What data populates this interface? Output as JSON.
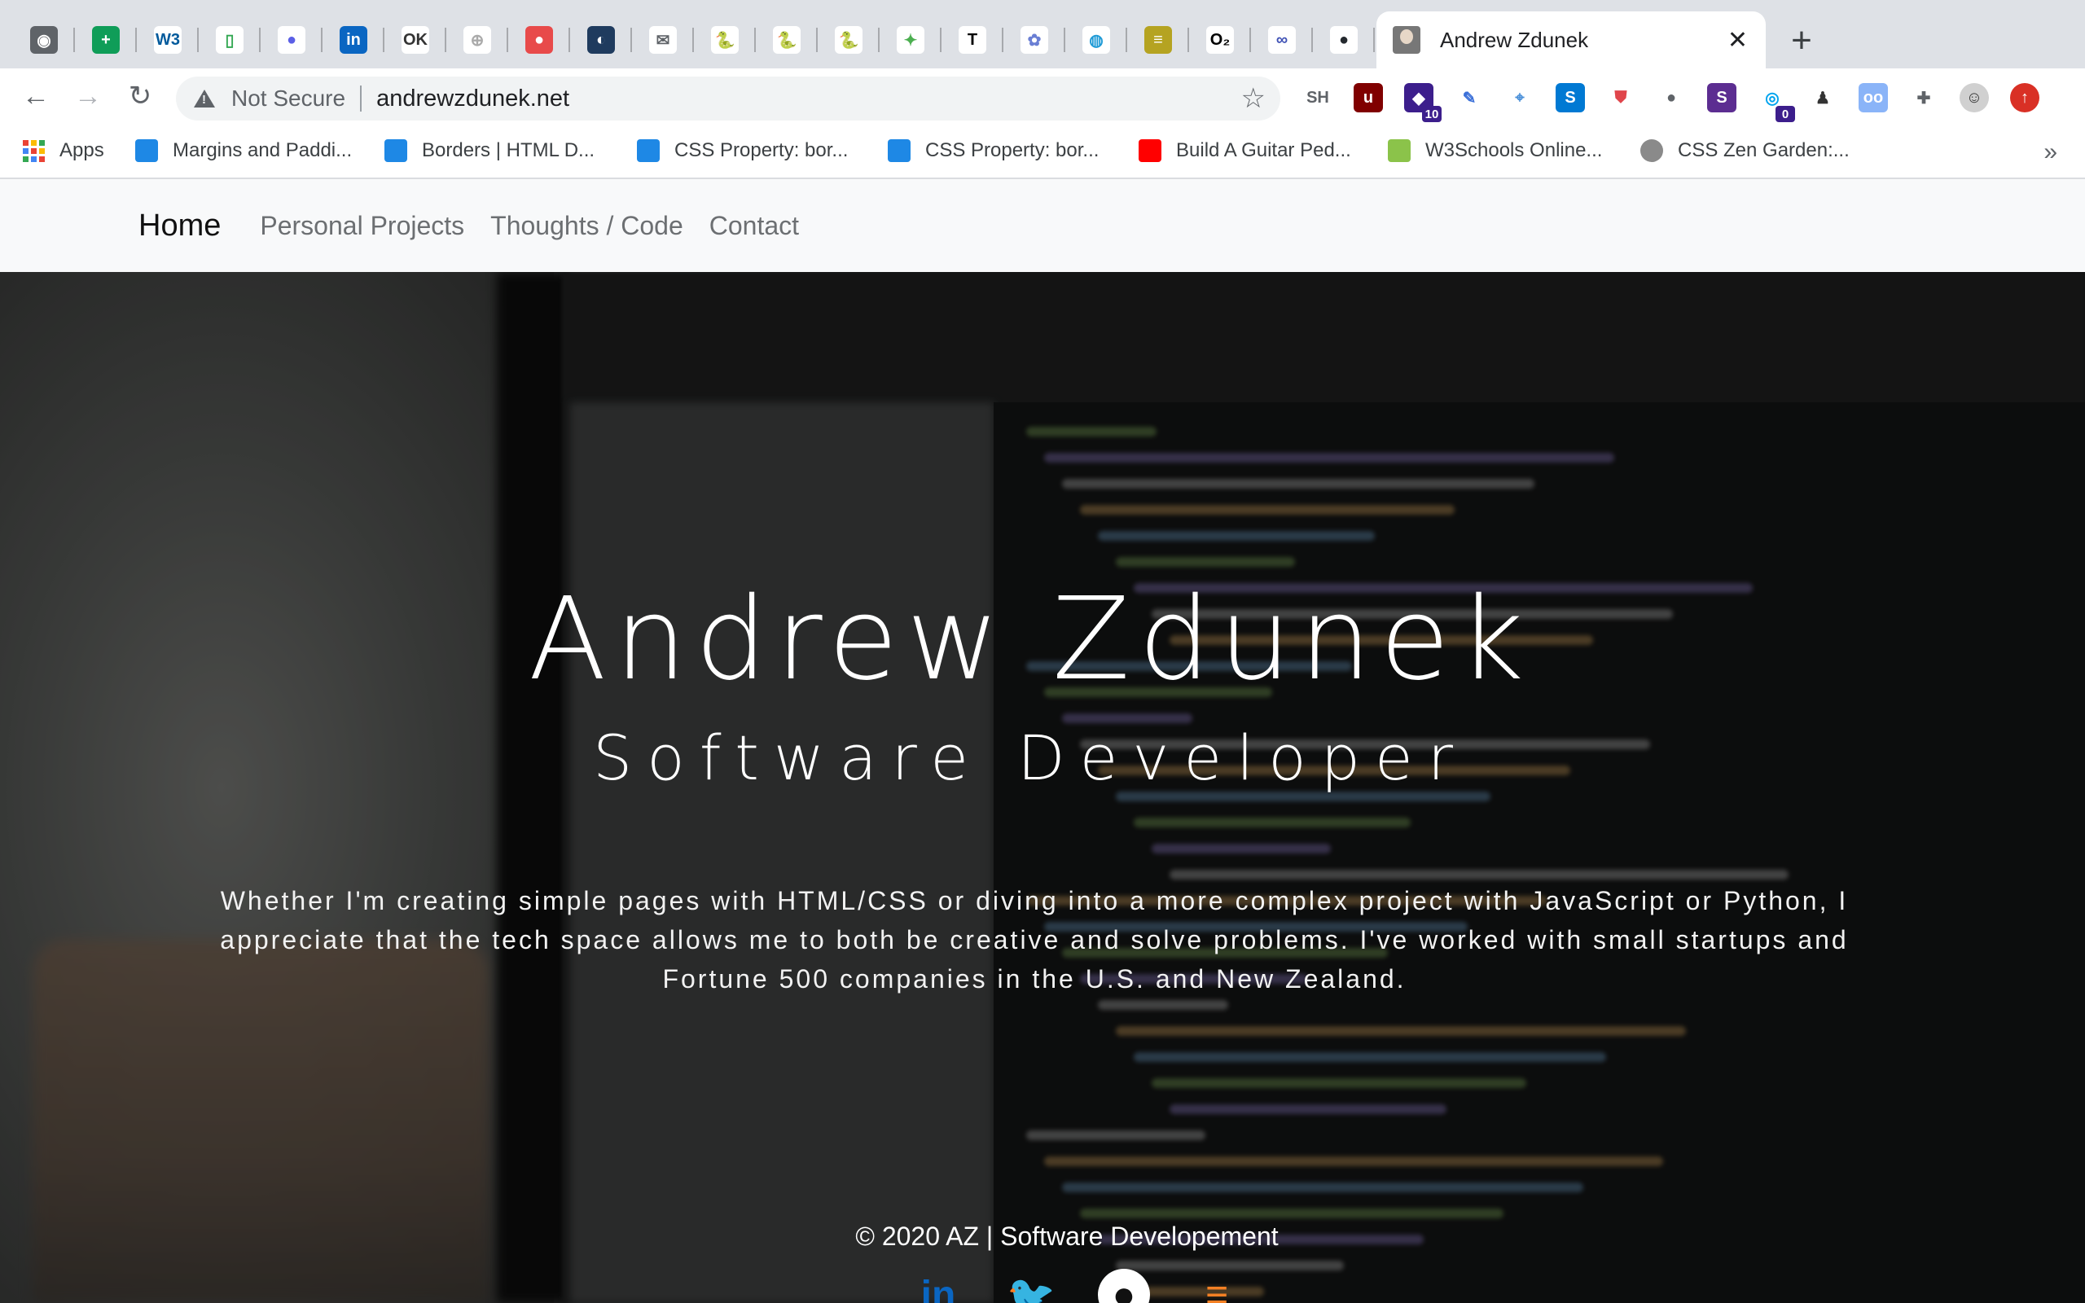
{
  "browser": {
    "pinned_tabs": [
      {
        "icon": "globe-icon",
        "glyph": "◉",
        "bg": "#5f6368"
      },
      {
        "icon": "google-sheets-icon",
        "glyph": "+",
        "bg": "#0f9d58"
      },
      {
        "icon": "w3c-icon",
        "glyph": "W3",
        "bg": "#ffffff",
        "fg": "#005a9c"
      },
      {
        "icon": "phone-outline-icon",
        "glyph": "▯",
        "bg": "#ffffff",
        "fg": "#34a853"
      },
      {
        "icon": "purple-circle-icon",
        "glyph": "●",
        "bg": "#ffffff",
        "fg": "#5b5fe6"
      },
      {
        "icon": "linkedin-icon",
        "glyph": "in",
        "bg": "#0a66c2"
      },
      {
        "icon": "ok-icon",
        "glyph": "OK",
        "bg": "#ffffff",
        "fg": "#333333"
      },
      {
        "icon": "crosshair-icon",
        "glyph": "⊕",
        "bg": "#ffffff",
        "fg": "#aaaaaa"
      },
      {
        "icon": "red-pin-icon",
        "glyph": "●",
        "bg": "#e84a4a"
      },
      {
        "icon": "blue-wave-icon",
        "glyph": "◐",
        "bg": "#1f3b5e"
      },
      {
        "icon": "mail-icon",
        "glyph": "✉",
        "bg": "#ffffff",
        "fg": "#5f6368"
      },
      {
        "icon": "python-icon",
        "glyph": "🐍",
        "bg": "#ffffff",
        "fg": "#3776ab"
      },
      {
        "icon": "python-icon",
        "glyph": "🐍",
        "bg": "#ffffff",
        "fg": "#3776ab"
      },
      {
        "icon": "python-icon",
        "glyph": "🐍",
        "bg": "#ffffff",
        "fg": "#3776ab"
      },
      {
        "icon": "plant-icon",
        "glyph": "✦",
        "bg": "#ffffff",
        "fg": "#4caf50"
      },
      {
        "icon": "text-t-icon",
        "glyph": "T",
        "bg": "#ffffff",
        "fg": "#000000"
      },
      {
        "icon": "flower-icon",
        "glyph": "✿",
        "bg": "#ffffff",
        "fg": "#6a7fd4"
      },
      {
        "icon": "globe-blue-icon",
        "glyph": "◍",
        "bg": "#ffffff",
        "fg": "#1e9ad6"
      },
      {
        "icon": "stack-icon",
        "glyph": "≡",
        "bg": "#b5a321"
      },
      {
        "icon": "o2-icon",
        "glyph": "O₂",
        "bg": "#ffffff",
        "fg": "#000000"
      },
      {
        "icon": "infinity-icon",
        "glyph": "∞",
        "bg": "#ffffff",
        "fg": "#3f51b5"
      },
      {
        "icon": "github-icon",
        "glyph": "●",
        "bg": "#ffffff",
        "fg": "#24292e"
      }
    ],
    "active_tab": {
      "title": "Andrew Zdunek",
      "close": "✕"
    },
    "new_tab": "+",
    "address": {
      "security": "Not Secure",
      "url": "andrewzdunek.net"
    },
    "extensions": [
      {
        "icon": "sh-text-icon",
        "glyph": "SH",
        "bg": "#ffffff",
        "fg": "#5f6368"
      },
      {
        "icon": "ublock-icon",
        "glyph": "u",
        "bg": "#800000"
      },
      {
        "icon": "graduation-cap-icon",
        "glyph": "◆",
        "bg": "#3c1e8c",
        "badge": "10"
      },
      {
        "icon": "feather-icon",
        "glyph": "✎",
        "bg": "#ffffff",
        "fg": "#3a6fd8"
      },
      {
        "icon": "map-icon",
        "glyph": "⌖",
        "bg": "#ffffff",
        "fg": "#4a90d9"
      },
      {
        "icon": "s-box-icon",
        "glyph": "S",
        "bg": "#0079d3"
      },
      {
        "icon": "shield-red-icon",
        "glyph": "⛊",
        "bg": "#ffffff",
        "fg": "#e0454b"
      },
      {
        "icon": "chat-bubble-icon",
        "glyph": "●",
        "bg": "#ffffff",
        "fg": "#5f6368"
      },
      {
        "icon": "s-purple-icon",
        "glyph": "S",
        "bg": "#5c2d91"
      },
      {
        "icon": "ghost-icon",
        "glyph": "◎",
        "bg": "#ffffff",
        "fg": "#00a4ef",
        "badge": "0"
      },
      {
        "icon": "person-icon",
        "glyph": "♟",
        "bg": "#ffffff",
        "fg": "#333333"
      },
      {
        "icon": "glasses-icon",
        "glyph": "oo",
        "bg": "#8ab4f8"
      },
      {
        "icon": "puzzle-icon",
        "glyph": "✚",
        "bg": "#ffffff",
        "fg": "#5f6368"
      },
      {
        "icon": "avatar-icon",
        "glyph": "☺",
        "bg": "#d0d0d0",
        "fg": "#333333"
      },
      {
        "icon": "update-icon",
        "glyph": "↑",
        "bg": "#d93025"
      }
    ],
    "bookmarks": [
      {
        "label": "Apps",
        "icon": "apps-grid-icon"
      },
      {
        "label": "Margins and Paddi...",
        "icon": "w3-feather-icon"
      },
      {
        "label": "Borders | HTML D...",
        "icon": "w3-feather-icon"
      },
      {
        "label": "CSS Property: bor...",
        "icon": "w3-feather-icon"
      },
      {
        "label": "CSS Property: bor...",
        "icon": "w3-feather-icon"
      },
      {
        "label": "Build A Guitar Ped...",
        "icon": "youtube-icon"
      },
      {
        "label": "W3Schools Online...",
        "icon": "w3schools-icon"
      },
      {
        "label": "CSS Zen Garden:...",
        "icon": "zen-garden-icon"
      }
    ],
    "bookmarks_overflow": "»"
  },
  "site": {
    "nav": {
      "brand": "Home",
      "links": [
        "Personal Projects",
        "Thoughts / Code",
        "Contact"
      ]
    },
    "hero": {
      "name": "Andrew Zdunek",
      "role": "Software Developer",
      "bio": "Whether I'm creating simple pages with HTML/CSS or diving into a more complex project with JavaScript or Python, I appreciate that the tech space allows me to both be creative and solve problems. I've worked with small startups and Fortune 500 companies in the U.S. and New Zealand."
    },
    "footer": "© 2020 AZ | Software Developement",
    "socials": [
      {
        "icon": "linkedin-icon",
        "glyph": "in",
        "color": "#0a66c2"
      },
      {
        "icon": "twitter-icon",
        "glyph": "🐦",
        "color": "#1da1f2"
      },
      {
        "icon": "github-icon",
        "glyph": "●",
        "color": "#ffffff"
      },
      {
        "icon": "stackoverflow-icon",
        "glyph": "≡",
        "color": "#f48024"
      }
    ]
  }
}
